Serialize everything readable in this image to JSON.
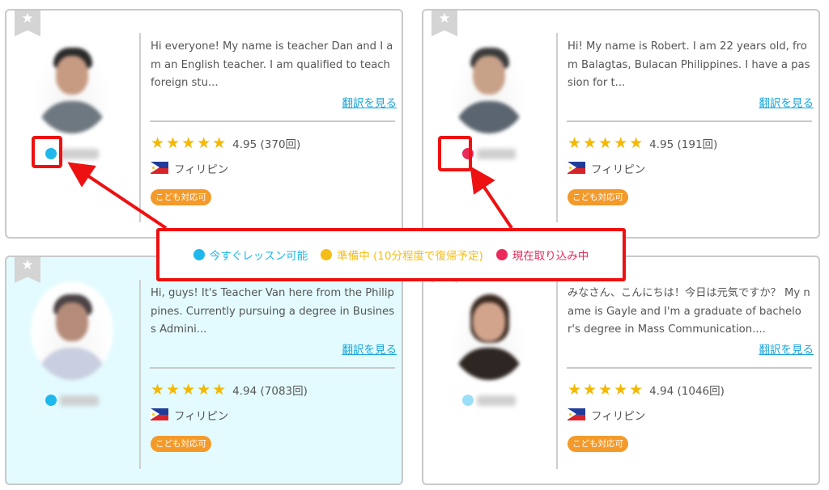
{
  "colors": {
    "available": "#1fb8ec",
    "preparing": "#f5bd17",
    "busy": "#ea2a5a",
    "annotation": "#ee1111",
    "star": "#f5b800",
    "badge": "#f39a2b",
    "link": "#1aa5d9"
  },
  "icons": {
    "bookmark": "star-bookmark-icon",
    "flag": "philippines-flag-icon"
  },
  "teachers": [
    {
      "status": "available",
      "intro": "Hi everyone! My name is teacher Dan and I am an English teacher. I am qualified to teach foreign stu...",
      "translate_label": "翻訳を見る",
      "stars": "★★★★★",
      "rating": "4.95 (370回)",
      "country": "フィリピン",
      "kids_badge": "こども対応可"
    },
    {
      "status": "busy",
      "intro": "Hi! My name is Robert. I am 22 years old, from Balagtas, Bulacan Philippines. I have a passion for t...",
      "translate_label": "翻訳を見る",
      "stars": "★★★★★",
      "rating": "4.95 (191回)",
      "country": "フィリピン",
      "kids_badge": "こども対応可"
    },
    {
      "status": "available",
      "intro": "Hi, guys! It's Teacher Van here from the Philippines. Currently pursuing a degree in Business Admini...",
      "translate_label": "翻訳を見る",
      "stars": "★★★★★",
      "rating": "4.94 (7083回)",
      "country": "フィリピン",
      "kids_badge": "こども対応可"
    },
    {
      "status": "available",
      "intro": "みなさん、こんにちは！今日は元気ですか？ My name is Gayle and I'm a graduate of bachelor's degree in Mass Communication....",
      "translate_label": "翻訳を見る",
      "stars": "★★★★★",
      "rating": "4.94 (1046回)",
      "country": "フィリピン",
      "kids_badge": "こども対応可"
    }
  ],
  "legend": [
    {
      "status": "available",
      "label": "今すぐレッスン可能"
    },
    {
      "status": "preparing",
      "label": "準備中 (10分程度で復帰予定)"
    },
    {
      "status": "busy",
      "label": "現在取り込み中"
    }
  ]
}
